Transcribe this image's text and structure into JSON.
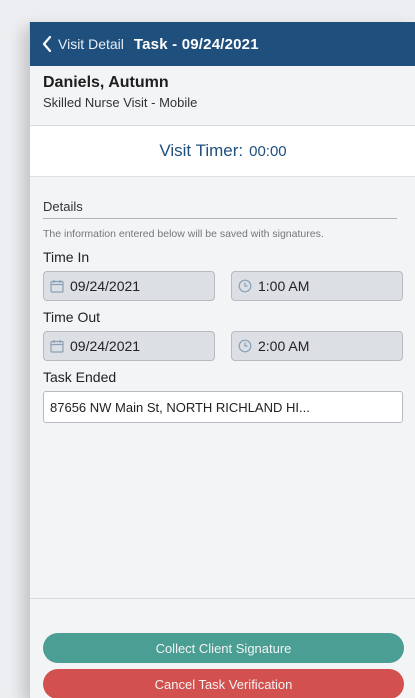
{
  "nav": {
    "back_label": "Visit Detail",
    "title": "Task - 09/24/2021"
  },
  "patient": {
    "name": "Daniels, Autumn",
    "visit_type": "Skilled Nurse Visit - Mobile"
  },
  "timer": {
    "label": "Visit Timer:",
    "value": "00:00"
  },
  "details": {
    "title": "Details",
    "helper": "The information entered below will be saved with signatures.",
    "time_in": {
      "label": "Time In",
      "date": "09/24/2021",
      "time": "1:00 AM"
    },
    "time_out": {
      "label": "Time Out",
      "date": "09/24/2021",
      "time": "2:00 AM"
    },
    "task_ended": {
      "label": "Task Ended",
      "value": "87656 NW Main St, NORTH RICHLAND HI..."
    }
  },
  "buttons": {
    "collect": "Collect Client Signature",
    "cancel": "Cancel Task Verification"
  },
  "colors": {
    "nav": "#1f4f7d",
    "collect": "#4a9e93",
    "cancel": "#d2514f"
  }
}
